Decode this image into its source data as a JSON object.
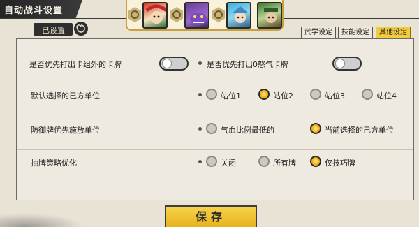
{
  "header": {
    "title": "自动战斗设置",
    "subtab_label": "已设置"
  },
  "portraits": [
    {
      "name": "hero-red-lion"
    },
    {
      "name": "hero-purple-beast"
    },
    {
      "name": "hero-blue-spirit"
    },
    {
      "name": "hero-green-warrior"
    }
  ],
  "tabs": [
    {
      "label": "武学设定",
      "active": false
    },
    {
      "label": "技能设定",
      "active": false
    },
    {
      "label": "其他设定",
      "active": true
    }
  ],
  "settings": {
    "row1": {
      "left_label": "是否优先打出卡组外的卡牌",
      "left_toggle_on": false,
      "right_label": "是否优先打出0怒气卡牌",
      "right_toggle_on": false
    },
    "row2": {
      "label": "默认选择的己方单位",
      "options": [
        {
          "label": "站位1",
          "selected": false
        },
        {
          "label": "站位2",
          "selected": true
        },
        {
          "label": "站位3",
          "selected": false
        },
        {
          "label": "站位4",
          "selected": false
        }
      ]
    },
    "row3": {
      "label": "防御牌优先施放单位",
      "options": [
        {
          "label": "气血比例最低的",
          "selected": false
        },
        {
          "label": "当前选择的己方单位",
          "selected": true
        }
      ]
    },
    "row4": {
      "label": "抽牌策略优化",
      "options": [
        {
          "label": "关闭",
          "selected": false
        },
        {
          "label": "所有牌",
          "selected": false
        },
        {
          "label": "仅技巧牌",
          "selected": true
        }
      ]
    }
  },
  "footer": {
    "save_label": "保存"
  },
  "colors": {
    "accent": "#f2b51a",
    "header_dark": "#2e2e2e",
    "panel_bg": "#efeae0"
  }
}
